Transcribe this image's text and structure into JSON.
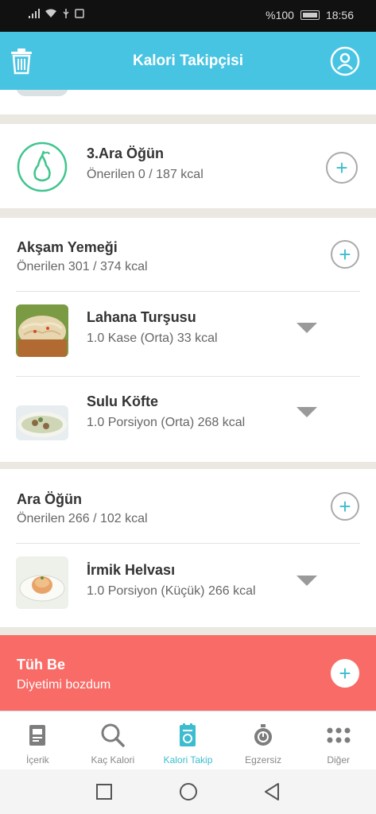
{
  "status": {
    "battery": "%100",
    "time": "18:56"
  },
  "header": {
    "title": "Kalori Takipçisi"
  },
  "sections": {
    "snack3": {
      "title": "3.Ara Öğün",
      "subtitle": "Önerilen 0 / 187 kcal"
    },
    "dinner": {
      "title": "Akşam Yemeği",
      "subtitle": "Önerilen 301 / 374 kcal",
      "items": [
        {
          "name": "Lahana Turşusu",
          "meta": "1.0 Kase (Orta) 33 kcal"
        },
        {
          "name": "Sulu Köfte",
          "meta": "1.0 Porsiyon (Orta) 268 kcal"
        }
      ]
    },
    "snack": {
      "title": "Ara Öğün",
      "subtitle": "Önerilen 266 / 102 kcal",
      "items": [
        {
          "name": "İrmik Helvası",
          "meta": "1.0 Porsiyon (Küçük) 266 kcal"
        }
      ]
    },
    "cheat": {
      "title": "Tüh Be",
      "subtitle": "Diyetimi bozdum"
    }
  },
  "nav": {
    "items": [
      {
        "label": "İçerik",
        "icon": "document-icon"
      },
      {
        "label": "Kaç Kalori",
        "icon": "search-icon"
      },
      {
        "label": "Kalori Takip",
        "icon": "tracker-icon"
      },
      {
        "label": "Egzersiz",
        "icon": "stopwatch-icon"
      },
      {
        "label": "Diğer",
        "icon": "more-dots-icon"
      }
    ],
    "active": "Kalori Takip"
  },
  "colors": {
    "header": "#48c4e3",
    "accent": "#3cbccf",
    "green": "#3fc58e",
    "cheat": "#f96b66"
  }
}
